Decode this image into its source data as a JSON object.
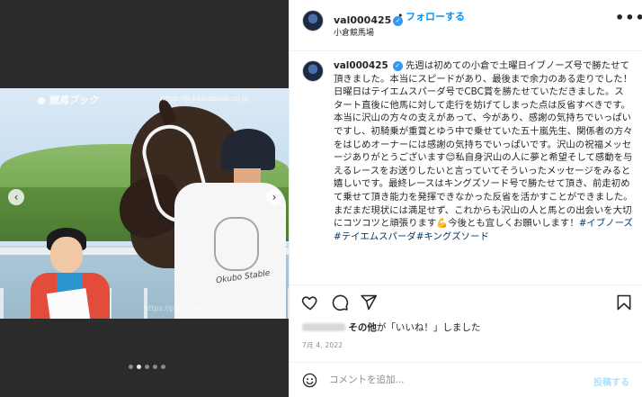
{
  "media": {
    "watermark_logo": "競馬ブック",
    "watermark_url": "https://p.keibabook.co.jp",
    "groom_shirt_text": "Okubo Stable",
    "prev_icon": "chevron-left-icon",
    "next_icon": "chevron-right-icon",
    "carousel_count": 5,
    "carousel_active_index": 1
  },
  "header": {
    "username": "val000425",
    "separator": "•",
    "follow_label": "フォローする",
    "location": "小倉競馬場",
    "more_icon": "•••"
  },
  "caption": {
    "username": "val000425",
    "body_1": "先週は初めての小倉で土曜日イブノーズ号で勝たせて頂きました。本当にスピードがあり、最後まで余力のある走りでした！\n日曜日はテイエムスパーダ号でCBC賞を勝たせていただきました。スタート直後に他馬に対して走行を妨げてしまった点は反省すべきです。本当に沢山の方々の支えがあって、今があり、感謝の気持ちでいっぱいですし、初騎乗が重賞とゆう中で乗せていた五十嵐先生、関係者の方々をはじめオーナーには感謝の気持ちでいっぱいです。沢山の祝福メッセージありがとうございます",
    "emoji_1": "😊",
    "body_2": "私自身沢山の人に夢と希望そして感動を与えるレースをお送りしたいと言っていてそういったメッセージをみると嬉しいです。最終レースはキングズソード号で勝たせて頂き、前走初めて乗せて頂き能力を発揮できなかった反省を活かすことができました。まだまだ現状には満足せず、これからも沢山の人と馬との出会いを大切にコツコツと頑張ります",
    "emoji_2": "💪",
    "body_3": "今後とも宜しくお願いします！",
    "hashtags": "#イブノーズ#テイエムスパーダ#キングズソード"
  },
  "actions": {
    "like_icon": "heart-icon",
    "comment_icon": "comment-icon",
    "share_icon": "paper-plane-icon",
    "save_icon": "bookmark-icon"
  },
  "likes": {
    "others_label": "その他",
    "suffix": "が「いいね！」しました"
  },
  "date": "7月 4, 2022",
  "comment": {
    "emoji_icon": "smiley-icon",
    "placeholder": "コメントを追加...",
    "post_label": "投稿する"
  },
  "colors": {
    "accent": "#0095f6",
    "verified": "#3897f0",
    "hashtag": "#00376b",
    "media_bg": "#2b2b2b"
  }
}
